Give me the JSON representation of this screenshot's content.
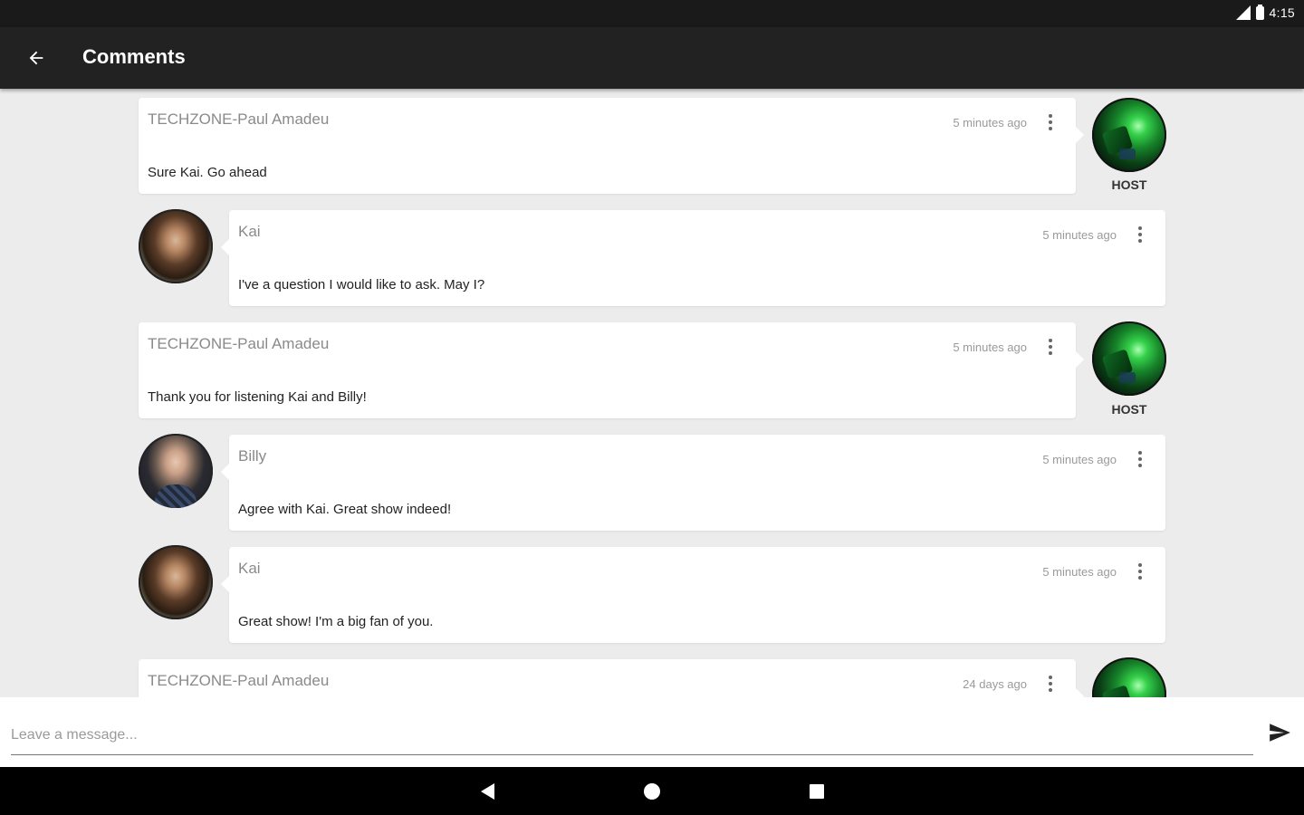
{
  "status_bar": {
    "network": "4G",
    "time": "4:15"
  },
  "app_bar": {
    "title": "Comments"
  },
  "comments": [
    {
      "author": "TECHZONE-Paul Amadeu",
      "time": "5 minutes ago",
      "text": "Sure Kai. Go ahead",
      "role": "host",
      "badge": "HOST"
    },
    {
      "author": "Kai",
      "time": "5 minutes ago",
      "text": "I've a question I would like to ask. May I?",
      "role": "guest"
    },
    {
      "author": "TECHZONE-Paul Amadeu",
      "time": "5 minutes ago",
      "text": "Thank you for listening Kai and Billy!",
      "role": "host",
      "badge": "HOST"
    },
    {
      "author": "Billy",
      "time": "5 minutes ago",
      "text": "Agree with Kai. Great show indeed!",
      "role": "guest"
    },
    {
      "author": "Kai",
      "time": "5 minutes ago",
      "text": "Great show! I'm a big fan of you.",
      "role": "guest"
    },
    {
      "author": "TECHZONE-Paul Amadeu",
      "time": "24 days ago",
      "text": "",
      "role": "host"
    }
  ],
  "composer": {
    "placeholder": "Leave a message..."
  },
  "colors": {
    "app_bar": "#222222",
    "background": "#ececec",
    "card": "#ffffff"
  }
}
